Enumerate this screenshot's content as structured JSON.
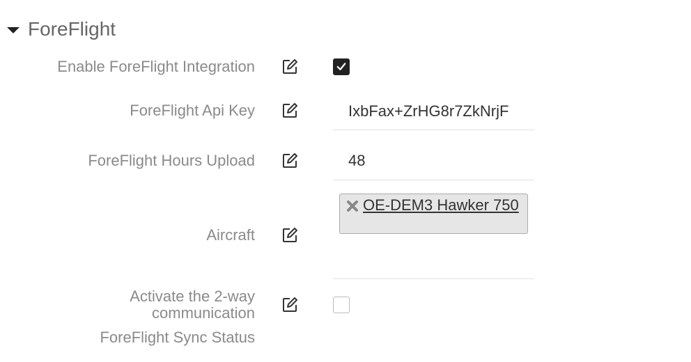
{
  "section": {
    "title": "ForeFlight"
  },
  "fields": [
    {
      "label": "Enable ForeFlight Integration",
      "type": "checkbox",
      "checked": true
    },
    {
      "label": "ForeFlight Api Key",
      "type": "text",
      "value": "IxbFax+ZrHG8r7ZkNrjF"
    },
    {
      "label": "ForeFlight Hours Upload",
      "type": "text",
      "value": "48"
    },
    {
      "label": "Aircraft",
      "type": "tags",
      "tags": [
        {
          "label": "OE-DEM3 Hawker 750"
        }
      ]
    },
    {
      "label_line1": "Activate the 2-way",
      "label_line2": "communication",
      "type": "checkbox",
      "checked": false
    },
    {
      "label": "ForeFlight Sync Status"
    }
  ],
  "icons": {
    "edit": "edit-icon",
    "remove": "remove-x-icon",
    "check": "checkmark-icon",
    "collapse": "caret-down-icon"
  },
  "colors": {
    "label": "#8a8a8a",
    "checkbox_checked": "#222222",
    "tag_bg": "#e6e6e6"
  }
}
